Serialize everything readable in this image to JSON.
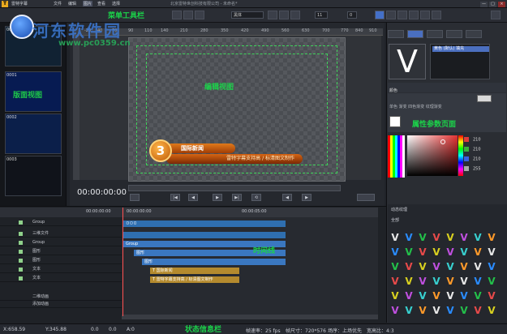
{
  "app": {
    "logo_letter": "T",
    "title": "雷特字幕",
    "window_title": "北京雷特世创科技有限公司 - 未命名*",
    "menu": [
      "文件",
      "编辑",
      "图片",
      "查看",
      "选择"
    ],
    "window_controls": [
      "—",
      "□",
      "×"
    ]
  },
  "toolbar": {
    "font_name": "黑体",
    "font_size": "11",
    "spacing": "0"
  },
  "thumbnails": [
    {
      "num": "0000",
      "label": ""
    },
    {
      "num": "0001",
      "label": "版面视图"
    },
    {
      "num": "0002",
      "label": ""
    },
    {
      "num": "0003",
      "label": ""
    }
  ],
  "editor": {
    "ruler_ticks": [
      "-20",
      "40",
      "70",
      "90",
      "110",
      "140",
      "210",
      "280",
      "350",
      "420",
      "490",
      "560",
      "630",
      "700",
      "770",
      "840",
      "910"
    ],
    "banner_number": "3",
    "banner_title": "国际新闻",
    "banner_subtitle": "雷特字幕支持高 / 标清图文制作",
    "timecode": "00:00:00:00"
  },
  "right_panel": {
    "preview_glyph": "V",
    "list_item": "黄色 (默认) 填充",
    "prop_title": "颜色",
    "prop_tabs": "单色  渐变  四色渐变  纹理渐变",
    "rgb": [
      {
        "label": "R",
        "value": "210",
        "color": "#e03a3a"
      },
      {
        "label": "G",
        "value": "210",
        "color": "#3ab03a"
      },
      {
        "label": "B",
        "value": "210",
        "color": "#3a5fe0"
      },
      {
        "label": "A",
        "value": "255",
        "color": "#aaaaaa"
      }
    ],
    "layer_title": "动态纹理",
    "layer_filter": "全部"
  },
  "timeline": {
    "header": "00:00:00:00",
    "ruler": [
      "00:00:00:00",
      "00:00:05:00"
    ],
    "rows": [
      {
        "name": "Group"
      },
      {
        "name": "三维文件"
      },
      {
        "name": "Group"
      },
      {
        "name": "图形"
      },
      {
        "name": "图形"
      },
      {
        "name": "文本"
      },
      {
        "name": "文本"
      }
    ],
    "bottom_rows": [
      "二维动画",
      "添加动画"
    ],
    "clips": [
      {
        "label": "ㅁㅁㅁ",
        "color": "#2f6fb0"
      },
      {
        "label": "",
        "color": "#2f6fb0"
      },
      {
        "label": "Group",
        "color": "#3a77c0"
      },
      {
        "label": "图形",
        "color": "#3a77c0"
      },
      {
        "label": "图形",
        "color": "#3a77c0"
      },
      {
        "label": "T 国际新闻",
        "color": "#b48a2e"
      },
      {
        "label": "T 雷特字幕支持高 / 标清图文制作",
        "color": "#b48a2e"
      }
    ]
  },
  "status": {
    "x": "X:658.59",
    "y": "Y:345.88",
    "vals": [
      "0.0",
      "0.0",
      "A:0"
    ],
    "fps": "帧速率：25 fps",
    "canvas_size": "帧尺寸：720*576",
    "field": "场序：上场优先",
    "ratio": "宽高比：4:3"
  },
  "annotations": {
    "menu_toolbar": "菜单工具栏",
    "edit_view": "编辑视图",
    "page_view": "版面视图",
    "properties": "属性参数页面",
    "timeline": "时间线",
    "status_bar": "状态信息栏"
  },
  "watermark": {
    "site_name": "河东软件园",
    "url": "www.pc0359.cn"
  }
}
